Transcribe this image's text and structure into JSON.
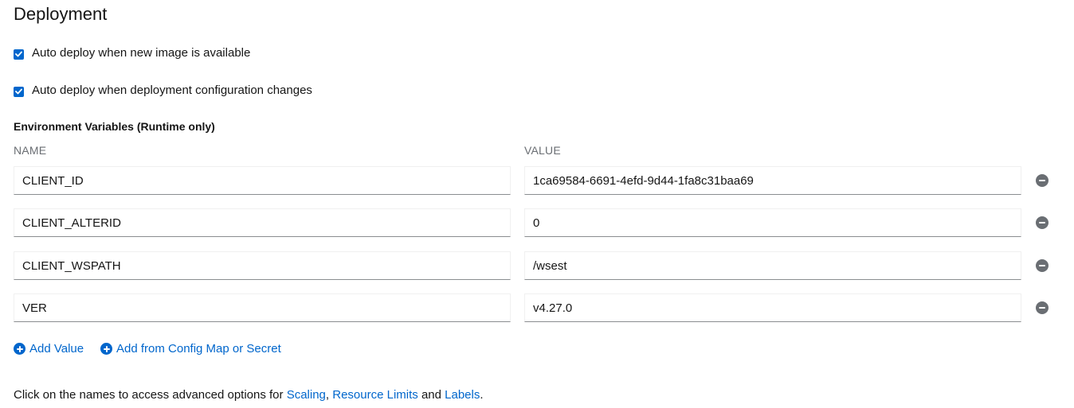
{
  "section": {
    "title": "Deployment"
  },
  "options": [
    {
      "label": "Auto deploy when new image is available",
      "checked": true
    },
    {
      "label": "Auto deploy when deployment configuration changes",
      "checked": true
    }
  ],
  "env": {
    "title": "Environment Variables (Runtime only)",
    "name_header": "NAME",
    "value_header": "VALUE",
    "rows": [
      {
        "name": "CLIENT_ID",
        "value": "1ca69584-6691-4efd-9d44-1fa8c31baa69"
      },
      {
        "name": "CLIENT_ALTERID",
        "value": "0"
      },
      {
        "name": "CLIENT_WSPATH",
        "value": "/wsest"
      },
      {
        "name": "VER",
        "value": "v4.27.0"
      }
    ],
    "add_value_label": "Add Value",
    "add_config_label": "Add from Config Map or Secret"
  },
  "footer": {
    "prefix": "Click on the names to access advanced options for ",
    "link_scaling": "Scaling",
    "sep_comma": ",",
    "link_resource_limits": "Resource Limits",
    "sep_and": " and ",
    "link_labels": "Labels",
    "suffix": "."
  },
  "colors": {
    "accent": "#0066cc",
    "text": "#151515",
    "muted": "#6a6e73",
    "remove_icon": "#6a6e73"
  }
}
